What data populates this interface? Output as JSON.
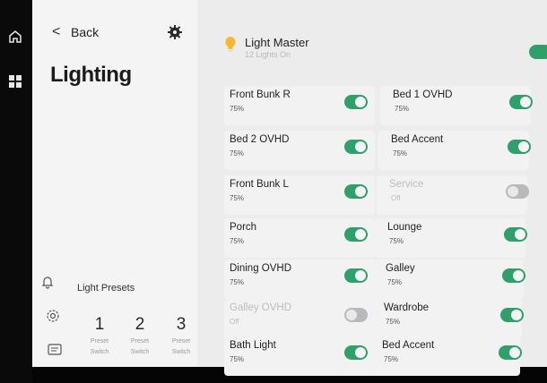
{
  "nav": {
    "back_label": "Back",
    "title": "Lighting",
    "icons": [
      "home-icon",
      "dashboard-icon",
      "bell-icon",
      "settings-icon",
      "message-icon"
    ]
  },
  "presets": {
    "label": "Light Presets",
    "items": [
      {
        "number": "1",
        "line1": "Preset",
        "line2": "Switch"
      },
      {
        "number": "2",
        "line1": "Preset",
        "line2": "Switch"
      },
      {
        "number": "3",
        "line1": "Preset",
        "line2": "Switch"
      }
    ]
  },
  "master": {
    "title": "Light Master",
    "subtitle": "12 Lights On",
    "on": true
  },
  "lights": [
    {
      "name": "Front Bunk R",
      "value": "75%",
      "on": true
    },
    {
      "name": "Bed 1 OVHD",
      "value": "75%",
      "on": true
    },
    {
      "name": "Bed 2 OVHD",
      "value": "75%",
      "on": true
    },
    {
      "name": "Bed Accent",
      "value": "75%",
      "on": true
    },
    {
      "name": "Front Bunk L",
      "value": "75%",
      "on": true
    },
    {
      "name": "Service",
      "value": "Off",
      "on": false
    },
    {
      "name": "Porch",
      "value": "75%",
      "on": true
    },
    {
      "name": "Lounge",
      "value": "75%",
      "on": true
    },
    {
      "name": "Dining OVHD",
      "value": "75%",
      "on": true
    },
    {
      "name": "Galley",
      "value": "75%",
      "on": true
    },
    {
      "name": "Galley OVHD",
      "value": "Off",
      "on": false
    },
    {
      "name": "Wardrobe",
      "value": "75%",
      "on": true
    },
    {
      "name": "Bath Light",
      "value": "75%",
      "on": true
    },
    {
      "name": "Bed Accent",
      "value": "75%",
      "on": true
    }
  ],
  "colors": {
    "toggle_on": "#2fa06a",
    "toggle_off": "#b7b9bd",
    "bulb": "#f5b82e"
  }
}
